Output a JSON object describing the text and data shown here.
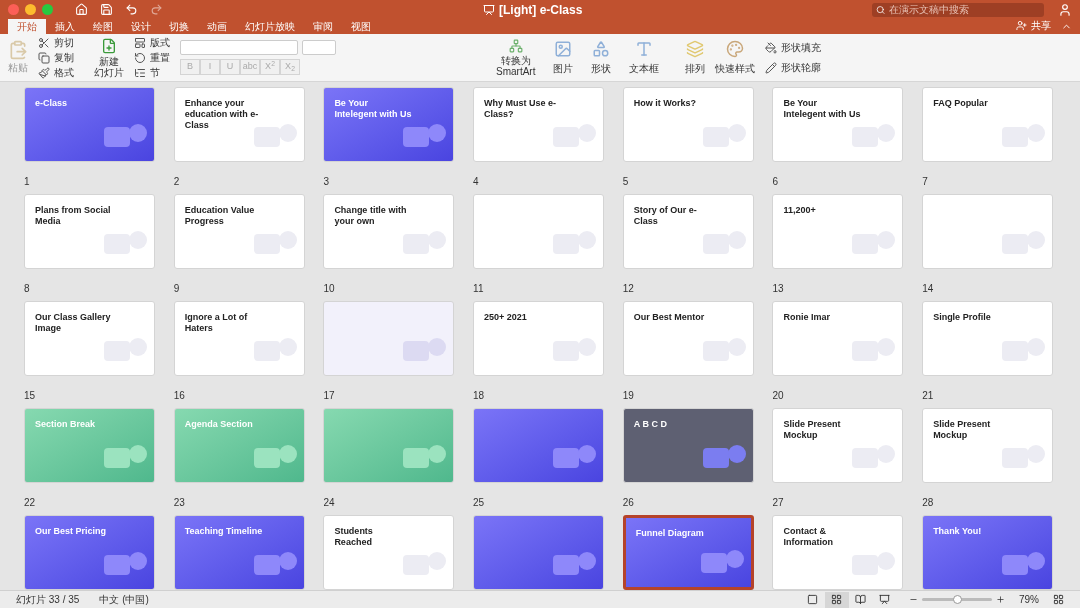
{
  "window": {
    "title": "[Light] e-Class",
    "search": {
      "placeholder": "在演示文稿中搜索"
    },
    "share": "共享"
  },
  "tabs": [
    {
      "label": "开始",
      "selected": true
    },
    {
      "label": "插入",
      "selected": false
    },
    {
      "label": "绘图",
      "selected": false
    },
    {
      "label": "设计",
      "selected": false
    },
    {
      "label": "切换",
      "selected": false
    },
    {
      "label": "动画",
      "selected": false
    },
    {
      "label": "幻灯片放映",
      "selected": false
    },
    {
      "label": "审阅",
      "selected": false
    },
    {
      "label": "视图",
      "selected": false
    }
  ],
  "ribbon": {
    "paste": "粘贴",
    "clipboard": [
      "剪切",
      "复制",
      "格式"
    ],
    "new_slide": [
      "新建",
      "幻灯片"
    ],
    "slide_tools": [
      "版式",
      "重置",
      "节"
    ],
    "format_buttons": [
      "B",
      "I",
      "U",
      "abc",
      "X$^{2}$",
      "X$_{2}$"
    ],
    "smartart": [
      "转换为",
      "SmartArt"
    ],
    "insert": [
      "图片",
      "形状",
      "文本框"
    ],
    "arrange": "排列",
    "quick_styles": "快速样式",
    "shape_fill": "形状填充",
    "shape_outline": "形状轮廓"
  },
  "slides": [
    {
      "number": "1",
      "kind": "blue",
      "title": "e-Class",
      "selected": false
    },
    {
      "number": "2",
      "kind": "white",
      "title": "Enhance your education with e-Class",
      "selected": false
    },
    {
      "number": "3",
      "kind": "blue",
      "title": "Be Your Intelegent with Us",
      "selected": false
    },
    {
      "number": "4",
      "kind": "white",
      "title": "Why Must Use e-Class?",
      "selected": false
    },
    {
      "number": "5",
      "kind": "white",
      "title": "How it Works?",
      "selected": false
    },
    {
      "number": "6",
      "kind": "white",
      "title": "Be Your Intelegent with Us",
      "selected": false
    },
    {
      "number": "7",
      "kind": "white",
      "title": "FAQ Popular",
      "selected": false
    },
    {
      "number": "8",
      "kind": "white",
      "title": "Plans from Social Media",
      "selected": false
    },
    {
      "number": "9",
      "kind": "white",
      "title": "Education Value Progress",
      "selected": false
    },
    {
      "number": "10",
      "kind": "white",
      "title": "Change title with your own",
      "selected": false
    },
    {
      "number": "11",
      "kind": "white",
      "selected": false
    },
    {
      "number": "12",
      "kind": "white",
      "title": "Story of Our e-Class",
      "selected": false
    },
    {
      "number": "13",
      "kind": "white",
      "title": "11,200+",
      "selected": false
    },
    {
      "number": "14",
      "kind": "white",
      "selected": false
    },
    {
      "number": "15",
      "kind": "white",
      "title": "Our Class Gallery Image",
      "selected": false
    },
    {
      "number": "16",
      "kind": "white",
      "title": "Ignore a Lot of Haters",
      "selected": false
    },
    {
      "number": "17",
      "kind": "lavender",
      "selected": false
    },
    {
      "number": "18",
      "kind": "white",
      "title": "250+  2021",
      "selected": false
    },
    {
      "number": "19",
      "kind": "white",
      "title": "Our Best Mentor",
      "selected": false
    },
    {
      "number": "20",
      "kind": "white",
      "title": "Ronie Imar",
      "selected": false
    },
    {
      "number": "21",
      "kind": "white",
      "title": "Single Profile",
      "selected": false
    },
    {
      "number": "22",
      "kind": "green",
      "title": "Section Break",
      "selected": false
    },
    {
      "number": "23",
      "kind": "green",
      "title": "Agenda Section",
      "selected": false
    },
    {
      "number": "24",
      "kind": "green",
      "selected": false
    },
    {
      "number": "25",
      "kind": "blue",
      "selected": false
    },
    {
      "number": "26",
      "kind": "gray",
      "title": "A B C D",
      "selected": false
    },
    {
      "number": "27",
      "kind": "white",
      "title": "Slide Present Mockup",
      "selected": false
    },
    {
      "number": "28",
      "kind": "white",
      "title": "Slide Present Mockup",
      "selected": false
    },
    {
      "kind": "blue",
      "title": "Our Best Pricing",
      "selected": false
    },
    {
      "kind": "blue",
      "title": "Teaching Timeline",
      "selected": false
    },
    {
      "kind": "white",
      "title": "Students Reached",
      "selected": false
    },
    {
      "kind": "blue",
      "selected": false
    },
    {
      "kind": "blue",
      "title": "Funnel Diagram",
      "selected": true
    },
    {
      "kind": "white",
      "title": "Contact & Information",
      "selected": false
    },
    {
      "kind": "blue",
      "title": "Thank You!",
      "selected": false
    }
  ],
  "status_bar": {
    "slide": "幻灯片 33 / 35",
    "language": "中文 (中国)",
    "views": [
      {
        "selected": false
      },
      {
        "selected": true
      },
      {
        "selected": false
      },
      {
        "selected": false
      }
    ],
    "zoom": {
      "level": 0.5,
      "reading": "79%"
    }
  }
}
